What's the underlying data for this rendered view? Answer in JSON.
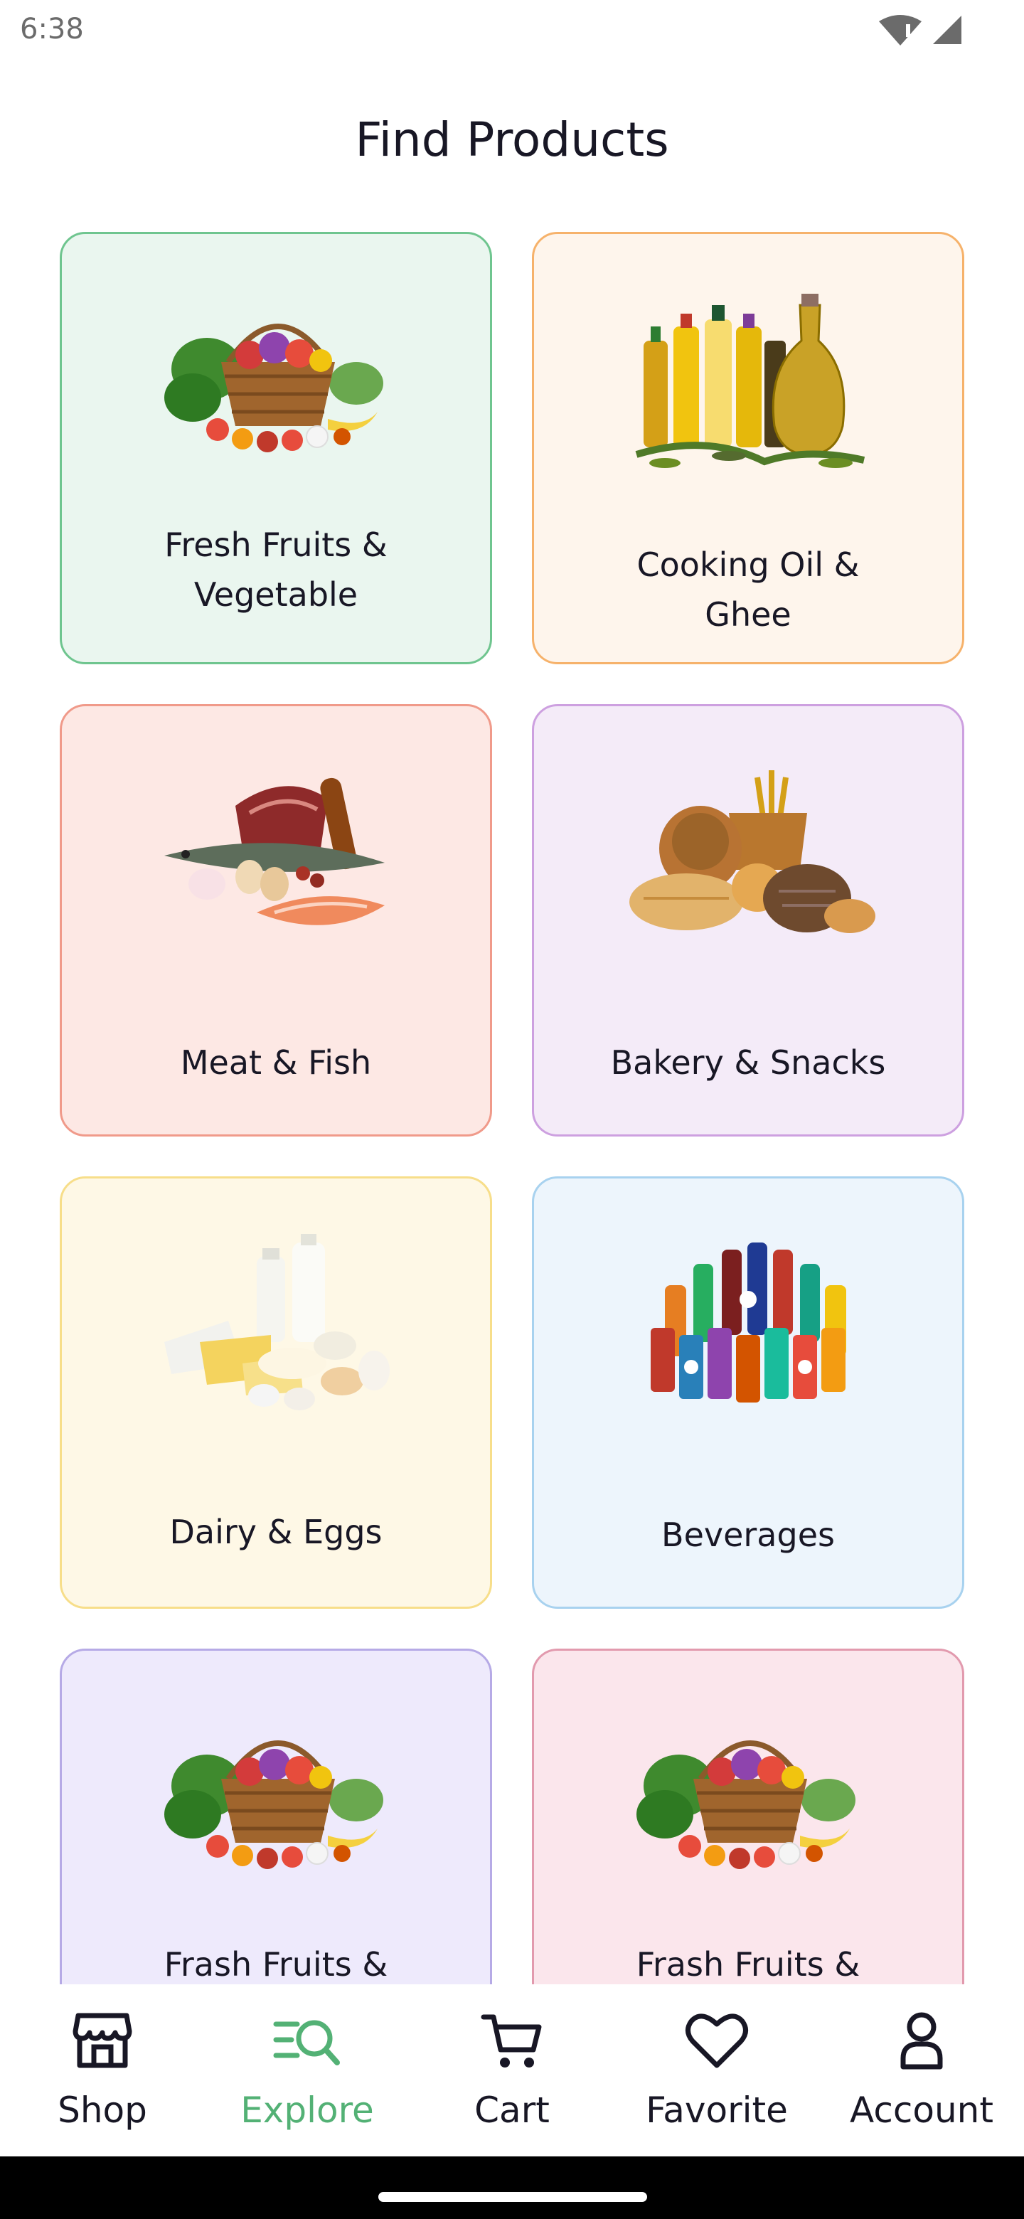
{
  "status_bar": {
    "time": "6:38"
  },
  "page": {
    "title": "Find Products"
  },
  "categories": [
    {
      "label": "Fresh Fruits &\nVegetable",
      "icon": "fruit-basket-image",
      "bg": "#eaf6ef",
      "border": "#6fc58f"
    },
    {
      "label": "Cooking Oil &\nGhee",
      "icon": "oil-bottles-image",
      "bg": "#fef5ec",
      "border": "#f6b26b"
    },
    {
      "label": "Meat & Fish",
      "icon": "meat-fish-image",
      "bg": "#fde8e4",
      "border": "#f09a8a"
    },
    {
      "label": "Bakery & Snacks",
      "icon": "bakery-image",
      "bg": "#f4ebf8",
      "border": "#cda0e0"
    },
    {
      "label": "Dairy & Eggs",
      "icon": "dairy-eggs-image",
      "bg": "#fef8e6",
      "border": "#f7de8a"
    },
    {
      "label": "Beverages",
      "icon": "beverages-image",
      "bg": "#edf5fc",
      "border": "#a8d2ef"
    },
    {
      "label": "Frash Fruits &",
      "icon": "fruit-basket-image",
      "bg": "#eeeafc",
      "border": "#b6aae6"
    },
    {
      "label": "Frash Fruits &",
      "icon": "fruit-basket-image",
      "bg": "#fbe6ec",
      "border": "#e29aae"
    }
  ],
  "nav": {
    "active_color": "#53b175",
    "items": [
      {
        "label": "Shop",
        "icon": "shop-icon"
      },
      {
        "label": "Explore",
        "icon": "explore-icon",
        "active": true
      },
      {
        "label": "Cart",
        "icon": "cart-icon"
      },
      {
        "label": "Favorite",
        "icon": "heart-icon"
      },
      {
        "label": "Account",
        "icon": "account-icon"
      }
    ]
  }
}
